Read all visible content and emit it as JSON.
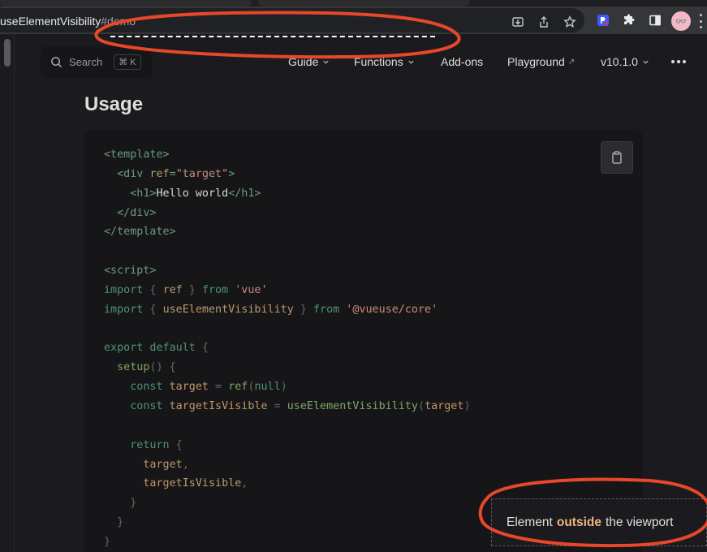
{
  "browser": {
    "url_main": "useElementVisibility",
    "url_hash": "#demo",
    "avatar_glyph": "👓"
  },
  "nav": {
    "search_label": "Search",
    "search_shortcut": "⌘ K",
    "items": [
      {
        "label": "Guide",
        "icon": "chevron-down-icon"
      },
      {
        "label": "Functions",
        "icon": "chevron-down-icon"
      },
      {
        "label": "Add-ons"
      },
      {
        "label": "Playground",
        "icon": "external-link-icon",
        "ext": "↗"
      },
      {
        "label": "v10.1.0",
        "icon": "chevron-down-icon"
      }
    ]
  },
  "section": {
    "title": "Usage"
  },
  "code": {
    "lines": [
      [
        [
          "tag",
          "<template>"
        ]
      ],
      [
        [
          "plain",
          "  "
        ],
        [
          "tag",
          "<div "
        ],
        [
          "attr",
          "ref"
        ],
        [
          "tag",
          "="
        ],
        [
          "str",
          "\"target\""
        ],
        [
          "tag",
          ">"
        ]
      ],
      [
        [
          "plain",
          "    "
        ],
        [
          "tag",
          "<h1>"
        ],
        [
          "txt",
          "Hello world"
        ],
        [
          "tag",
          "</h1>"
        ]
      ],
      [
        [
          "plain",
          "  "
        ],
        [
          "tag",
          "</div>"
        ]
      ],
      [
        [
          "tag",
          "</template>"
        ]
      ],
      [],
      [
        [
          "tag",
          "<script>"
        ]
      ],
      [
        [
          "kw",
          "import"
        ],
        [
          "punc",
          " { "
        ],
        [
          "var",
          "ref"
        ],
        [
          "punc",
          " } "
        ],
        [
          "kw",
          "from"
        ],
        [
          "str",
          " 'vue'"
        ]
      ],
      [
        [
          "kw",
          "import"
        ],
        [
          "punc",
          " { "
        ],
        [
          "var",
          "useElementVisibility"
        ],
        [
          "punc",
          " } "
        ],
        [
          "kw",
          "from"
        ],
        [
          "str",
          " '@vueuse/core'"
        ]
      ],
      [],
      [
        [
          "kw",
          "export default"
        ],
        [
          "punc",
          " {"
        ]
      ],
      [
        [
          "plain",
          "  "
        ],
        [
          "fn",
          "setup"
        ],
        [
          "punc",
          "() {"
        ]
      ],
      [
        [
          "plain",
          "    "
        ],
        [
          "kw",
          "const"
        ],
        [
          "var",
          " target"
        ],
        [
          "punc",
          " = "
        ],
        [
          "fn",
          "ref"
        ],
        [
          "punc",
          "("
        ],
        [
          "kw",
          "null"
        ],
        [
          "punc",
          ")"
        ]
      ],
      [
        [
          "plain",
          "    "
        ],
        [
          "kw",
          "const"
        ],
        [
          "var",
          " targetIsVisible"
        ],
        [
          "punc",
          " = "
        ],
        [
          "fn",
          "useElementVisibility"
        ],
        [
          "punc",
          "("
        ],
        [
          "var",
          "target"
        ],
        [
          "punc",
          ")"
        ]
      ],
      [],
      [
        [
          "plain",
          "    "
        ],
        [
          "kw",
          "return"
        ],
        [
          "punc",
          " {"
        ]
      ],
      [
        [
          "plain",
          "      "
        ],
        [
          "var",
          "target"
        ],
        [
          "punc",
          ","
        ]
      ],
      [
        [
          "plain",
          "      "
        ],
        [
          "var",
          "targetIsVisible"
        ],
        [
          "punc",
          ","
        ]
      ],
      [
        [
          "plain",
          "    "
        ],
        [
          "punc",
          "}"
        ]
      ],
      [
        [
          "plain",
          "  "
        ],
        [
          "punc",
          "}"
        ]
      ],
      [
        [
          "punc",
          "}"
        ]
      ]
    ]
  },
  "visibility": {
    "prefix": "Element",
    "state": "outside",
    "suffix": "the viewport"
  },
  "colors": {
    "annotation": "#e8472b",
    "accent_state": "#f0b37e"
  }
}
